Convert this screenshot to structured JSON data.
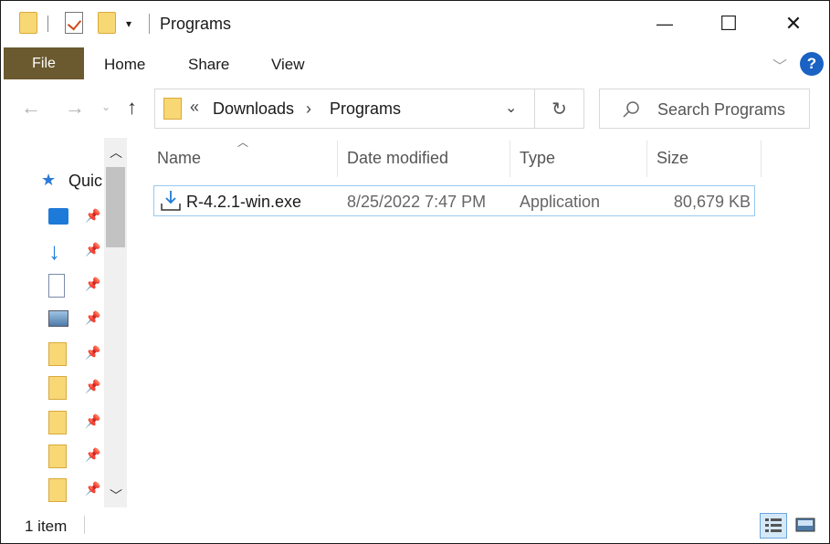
{
  "window": {
    "title": "Programs",
    "controls": {
      "minimize": "—",
      "maximize": "☐",
      "close": "✕"
    }
  },
  "ribbon": {
    "file": "File",
    "tabs": [
      "Home",
      "Share",
      "View"
    ],
    "help": "?"
  },
  "address": {
    "overflow": "«",
    "segments": [
      "Downloads",
      "Programs"
    ],
    "separator": "›"
  },
  "search": {
    "placeholder": "Search Programs"
  },
  "nav_pane": {
    "quick_access_label": "Quic"
  },
  "columns": {
    "name": "Name",
    "date": "Date modified",
    "type": "Type",
    "size": "Size"
  },
  "files": [
    {
      "name": "R-4.2.1-win.exe",
      "date": "8/25/2022 7:47 PM",
      "type": "Application",
      "size": "80,679 KB"
    }
  ],
  "status": {
    "count": "1 item"
  },
  "colors": {
    "file_tab": "#6b5a2f",
    "help": "#1a62c4",
    "selection_border": "#99c9ef",
    "folder": "#f8d775"
  }
}
